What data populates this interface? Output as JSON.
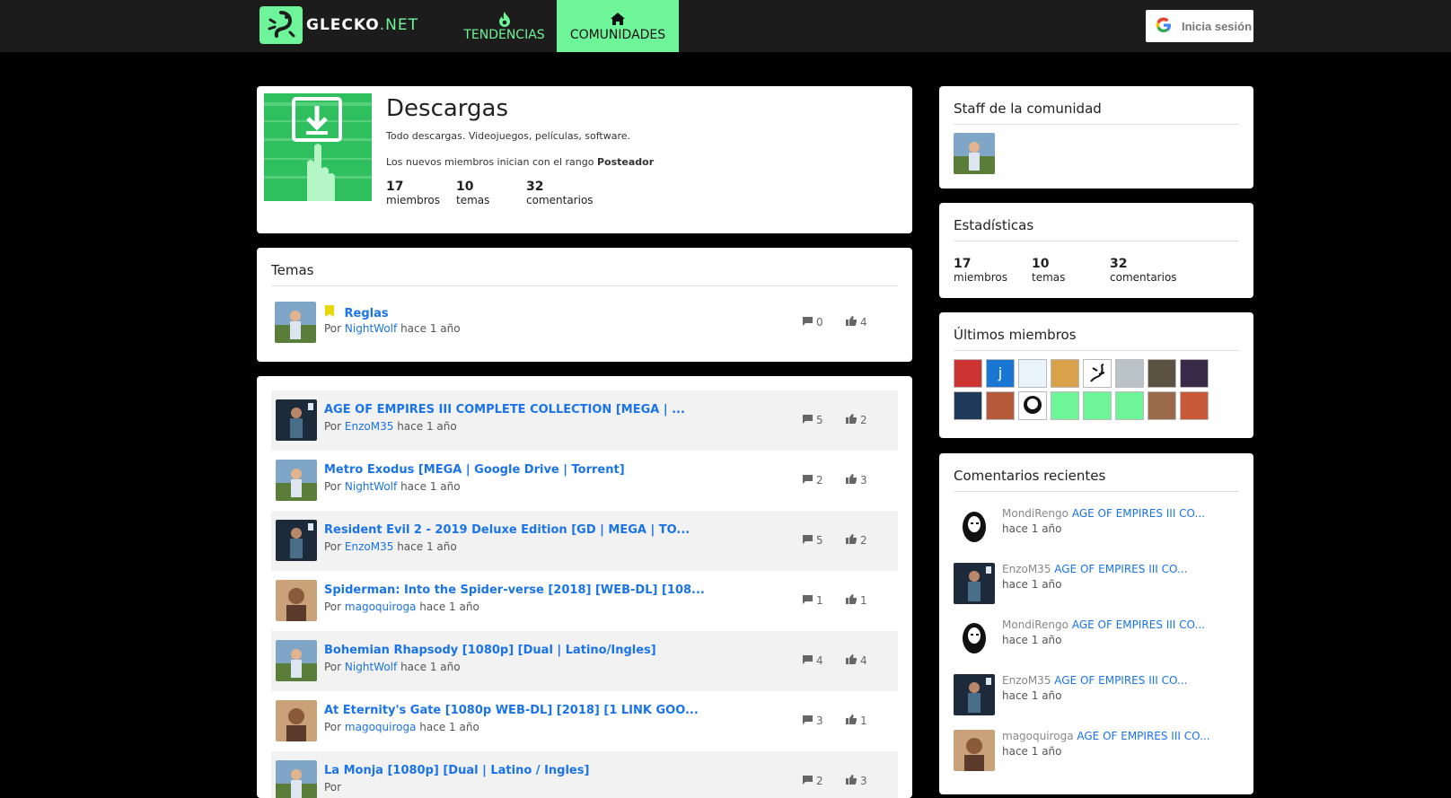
{
  "header": {
    "logo_text": "GLECKO",
    "logo_suffix": ".NET",
    "nav": [
      {
        "label": "Tendencias",
        "icon": "flame-icon"
      },
      {
        "label": "Comunidades",
        "icon": "home-icon"
      }
    ],
    "login_label": "Inicia sesión"
  },
  "community": {
    "name": "Descargas",
    "description": "Todo descargas. Videojuegos, películas, software.",
    "rank_prefix": "Los nuevos miembros inician con el rango",
    "rank": "Posteador",
    "stats": [
      {
        "value": "17",
        "label": "miembros"
      },
      {
        "value": "10",
        "label": "temas"
      },
      {
        "value": "32",
        "label": "comentarios"
      }
    ]
  },
  "pinned": {
    "title": "Temas",
    "topic": {
      "title": "Reglas",
      "by": "Por",
      "user": "NightWolf",
      "time": "hace 1 año",
      "comments": "0",
      "likes": "4"
    }
  },
  "topics": [
    {
      "title": "AGE OF EMPIRES III COMPLETE COLLECTION [MEGA | ...",
      "by": "Por",
      "user": "EnzoM35",
      "time": "hace 1 año",
      "comments": "5",
      "likes": "2"
    },
    {
      "title": "Metro Exodus [MEGA | Google Drive | Torrent]",
      "by": "Por",
      "user": "NightWolf",
      "time": "hace 1 año",
      "comments": "2",
      "likes": "3"
    },
    {
      "title": "Resident Evil 2 - 2019 Deluxe Edition [GD | MEGA | TO...",
      "by": "Por",
      "user": "EnzoM35",
      "time": "hace 1 año",
      "comments": "5",
      "likes": "2"
    },
    {
      "title": "Spiderman: Into the Spider-verse [2018] [WEB-DL] [108...",
      "by": "Por",
      "user": "magoquiroga",
      "time": "hace 1 año",
      "comments": "1",
      "likes": "1"
    },
    {
      "title": "Bohemian Rhapsody [1080p] [Dual | Latino/Ingles]",
      "by": "Por",
      "user": "NightWolf",
      "time": "hace 1 año",
      "comments": "4",
      "likes": "4"
    },
    {
      "title": "At Eternity's Gate [1080p WEB-DL] [2018] [1 LINK GOO...",
      "by": "Por",
      "user": "magoquiroga",
      "time": "hace 1 año",
      "comments": "3",
      "likes": "1"
    },
    {
      "title": "La Monja [1080p] [Dual | Latino / Ingles]",
      "by": "Por",
      "user": "",
      "time": "",
      "comments": "2",
      "likes": "3"
    }
  ],
  "sidebar": {
    "staff_title": "Staff de la comunidad",
    "stats_title": "Estadísticas",
    "stats": [
      {
        "value": "17",
        "label": "miembros"
      },
      {
        "value": "10",
        "label": "temas"
      },
      {
        "value": "32",
        "label": "comentarios"
      }
    ],
    "members_title": "Últimos miembros",
    "comments_title": "Comentarios recientes",
    "comments": [
      {
        "user": "MondiRengo",
        "topic": "AGE OF EMPIRES III CO...",
        "time": "hace 1 año"
      },
      {
        "user": "EnzoM35",
        "topic": "AGE OF EMPIRES III CO...",
        "time": "hace 1 año"
      },
      {
        "user": "MondiRengo",
        "topic": "AGE OF EMPIRES III CO...",
        "time": "hace 1 año"
      },
      {
        "user": "EnzoM35",
        "topic": "AGE OF EMPIRES III CO...",
        "time": "hace 1 año"
      },
      {
        "user": "magoquiroga",
        "topic": "AGE OF EMPIRES III CO...",
        "time": "hace 1 año"
      }
    ]
  },
  "colors": {
    "accent": "#6ef59a",
    "link": "#1a73e8",
    "pin": "#e8d80a"
  }
}
